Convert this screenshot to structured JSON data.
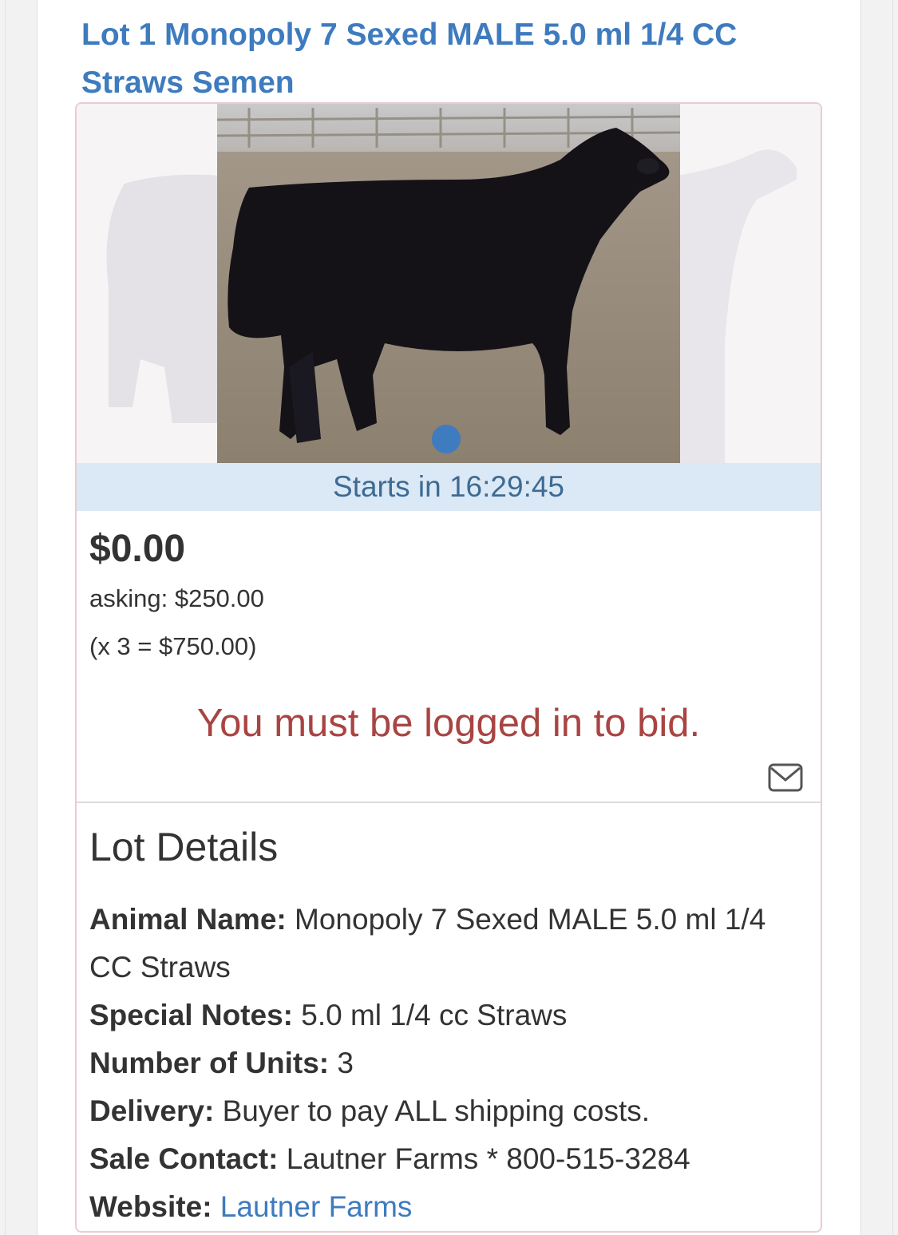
{
  "lot": {
    "title": "Lot 1 Monopoly 7 Sexed MALE 5.0 ml 1/4 CC Straws Semen"
  },
  "photo": {
    "icon": "cow-photo",
    "carousel_indicator_color": "#3e7bbf"
  },
  "auction": {
    "starts_label": "Starts in 16:29:45",
    "current_price": "$0.00",
    "asking": "asking: $250.00",
    "total": "(x 3 = $750.00)",
    "login_message": "You must be logged in to bid."
  },
  "details": {
    "heading": "Lot Details",
    "fields": [
      {
        "label": "Animal Name:",
        "value": "Monopoly 7 Sexed MALE 5.0 ml 1/4 CC Straws"
      },
      {
        "label": "Special Notes:",
        "value": "5.0 ml 1/4 cc Straws"
      },
      {
        "label": "Number of Units:",
        "value": "3"
      },
      {
        "label": "Delivery:",
        "value": "Buyer to pay ALL shipping costs."
      },
      {
        "label": "Sale Contact:",
        "value": "Lautner Farms * 800-515-3284"
      },
      {
        "label": "Website:",
        "value": "Lautner Farms"
      }
    ]
  },
  "colors": {
    "link": "#3e7bbf",
    "alert": "#a94442",
    "status_bar": "#dbe8f5",
    "card_border": "#ebccd1"
  }
}
